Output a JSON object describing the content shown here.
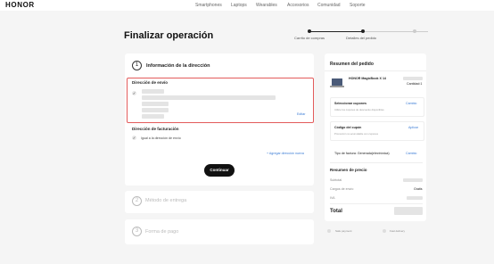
{
  "header": {
    "logo": "HONOR",
    "nav": [
      "Smartphones",
      "Laptops",
      "Wearables",
      "Accesorios",
      "Comunidad",
      "Soporte"
    ]
  },
  "page": {
    "title": "Finalizar operación",
    "steps": [
      "Carrito de compras",
      "Detalles del pedido"
    ]
  },
  "address_section": {
    "number": "1",
    "title": "Información de la dirección",
    "shipping_title": "Dirección de envío",
    "edit_label": "Editar",
    "billing_title": "Dirección de facturación",
    "billing_same_label": "Igual a la dirección de envío",
    "add_billing_link": "+ Agregar dirección nueva",
    "continue_label": "Continuar"
  },
  "delivery_section": {
    "number": "2",
    "title": "Método de entrega"
  },
  "payment_section": {
    "number": "3",
    "title": "Forma de pago"
  },
  "summary": {
    "title": "Resumen del pedido",
    "product_name": "HONOR MagicBook X 14",
    "quantity_label": "Cantidad:1",
    "coupons_title": "Seleccionar cupones",
    "coupons_hint": "Utilice los cupones de descuento disponibles",
    "coupons_action": "Cambio",
    "coupon_code_title": "Código del cupón",
    "coupon_code_hint": "Promoción no acumulable con cupones",
    "coupon_code_action": "Aplicar",
    "invoice_label": "Tipo de factura: Generada(electrónica)",
    "invoice_action": "Cambio",
    "price_title": "Resumen de precio",
    "subtotal_label": "Subtotal",
    "shipping_label": "Cargos de envío",
    "shipping_value": "Gratis",
    "tax_label": "IVA",
    "total_label": "Total",
    "footer_links": [
      "Safe payment",
      "Fast delivery"
    ]
  }
}
